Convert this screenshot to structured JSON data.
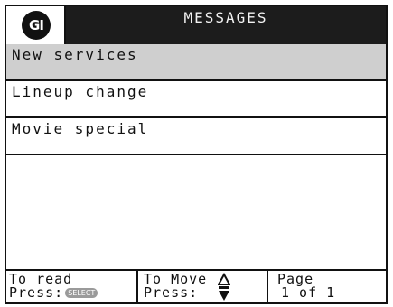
{
  "header": {
    "logo_text": "GI",
    "title": "MESSAGES"
  },
  "messages": [
    {
      "label": "New services",
      "selected": true
    },
    {
      "label": "Lineup change",
      "selected": false
    },
    {
      "label": "Movie special",
      "selected": false
    }
  ],
  "footer": {
    "read": {
      "line1": "To read",
      "press": "Press:",
      "button": "SELECT"
    },
    "move": {
      "line1": "To Move",
      "press": "Press:",
      "icon": "up-down-arrows-icon"
    },
    "page": {
      "label": "Page",
      "indicator": "1 of 1"
    }
  },
  "colors": {
    "header_bg": "#1c1c1c",
    "selected_bg": "#cfcfcf",
    "select_pill": "#9a9a9a"
  }
}
